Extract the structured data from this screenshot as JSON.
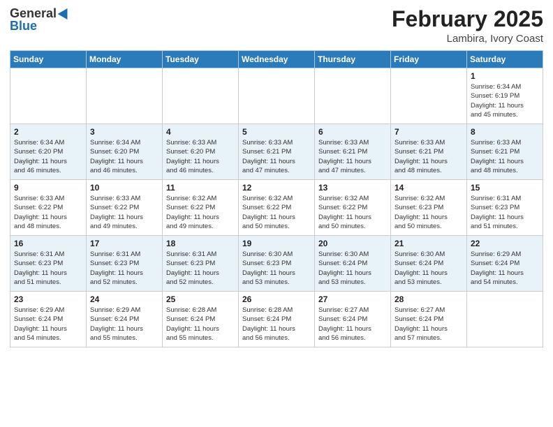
{
  "header": {
    "logo_general": "General",
    "logo_blue": "Blue",
    "title": "February 2025",
    "subtitle": "Lambira, Ivory Coast"
  },
  "days_of_week": [
    "Sunday",
    "Monday",
    "Tuesday",
    "Wednesday",
    "Thursday",
    "Friday",
    "Saturday"
  ],
  "weeks": [
    [
      {
        "day": "",
        "info": ""
      },
      {
        "day": "",
        "info": ""
      },
      {
        "day": "",
        "info": ""
      },
      {
        "day": "",
        "info": ""
      },
      {
        "day": "",
        "info": ""
      },
      {
        "day": "",
        "info": ""
      },
      {
        "day": "1",
        "info": "Sunrise: 6:34 AM\nSunset: 6:19 PM\nDaylight: 11 hours\nand 45 minutes."
      }
    ],
    [
      {
        "day": "2",
        "info": "Sunrise: 6:34 AM\nSunset: 6:20 PM\nDaylight: 11 hours\nand 46 minutes."
      },
      {
        "day": "3",
        "info": "Sunrise: 6:34 AM\nSunset: 6:20 PM\nDaylight: 11 hours\nand 46 minutes."
      },
      {
        "day": "4",
        "info": "Sunrise: 6:33 AM\nSunset: 6:20 PM\nDaylight: 11 hours\nand 46 minutes."
      },
      {
        "day": "5",
        "info": "Sunrise: 6:33 AM\nSunset: 6:21 PM\nDaylight: 11 hours\nand 47 minutes."
      },
      {
        "day": "6",
        "info": "Sunrise: 6:33 AM\nSunset: 6:21 PM\nDaylight: 11 hours\nand 47 minutes."
      },
      {
        "day": "7",
        "info": "Sunrise: 6:33 AM\nSunset: 6:21 PM\nDaylight: 11 hours\nand 48 minutes."
      },
      {
        "day": "8",
        "info": "Sunrise: 6:33 AM\nSunset: 6:21 PM\nDaylight: 11 hours\nand 48 minutes."
      }
    ],
    [
      {
        "day": "9",
        "info": "Sunrise: 6:33 AM\nSunset: 6:22 PM\nDaylight: 11 hours\nand 48 minutes."
      },
      {
        "day": "10",
        "info": "Sunrise: 6:33 AM\nSunset: 6:22 PM\nDaylight: 11 hours\nand 49 minutes."
      },
      {
        "day": "11",
        "info": "Sunrise: 6:32 AM\nSunset: 6:22 PM\nDaylight: 11 hours\nand 49 minutes."
      },
      {
        "day": "12",
        "info": "Sunrise: 6:32 AM\nSunset: 6:22 PM\nDaylight: 11 hours\nand 50 minutes."
      },
      {
        "day": "13",
        "info": "Sunrise: 6:32 AM\nSunset: 6:22 PM\nDaylight: 11 hours\nand 50 minutes."
      },
      {
        "day": "14",
        "info": "Sunrise: 6:32 AM\nSunset: 6:23 PM\nDaylight: 11 hours\nand 50 minutes."
      },
      {
        "day": "15",
        "info": "Sunrise: 6:31 AM\nSunset: 6:23 PM\nDaylight: 11 hours\nand 51 minutes."
      }
    ],
    [
      {
        "day": "16",
        "info": "Sunrise: 6:31 AM\nSunset: 6:23 PM\nDaylight: 11 hours\nand 51 minutes."
      },
      {
        "day": "17",
        "info": "Sunrise: 6:31 AM\nSunset: 6:23 PM\nDaylight: 11 hours\nand 52 minutes."
      },
      {
        "day": "18",
        "info": "Sunrise: 6:31 AM\nSunset: 6:23 PM\nDaylight: 11 hours\nand 52 minutes."
      },
      {
        "day": "19",
        "info": "Sunrise: 6:30 AM\nSunset: 6:23 PM\nDaylight: 11 hours\nand 53 minutes."
      },
      {
        "day": "20",
        "info": "Sunrise: 6:30 AM\nSunset: 6:24 PM\nDaylight: 11 hours\nand 53 minutes."
      },
      {
        "day": "21",
        "info": "Sunrise: 6:30 AM\nSunset: 6:24 PM\nDaylight: 11 hours\nand 53 minutes."
      },
      {
        "day": "22",
        "info": "Sunrise: 6:29 AM\nSunset: 6:24 PM\nDaylight: 11 hours\nand 54 minutes."
      }
    ],
    [
      {
        "day": "23",
        "info": "Sunrise: 6:29 AM\nSunset: 6:24 PM\nDaylight: 11 hours\nand 54 minutes."
      },
      {
        "day": "24",
        "info": "Sunrise: 6:29 AM\nSunset: 6:24 PM\nDaylight: 11 hours\nand 55 minutes."
      },
      {
        "day": "25",
        "info": "Sunrise: 6:28 AM\nSunset: 6:24 PM\nDaylight: 11 hours\nand 55 minutes."
      },
      {
        "day": "26",
        "info": "Sunrise: 6:28 AM\nSunset: 6:24 PM\nDaylight: 11 hours\nand 56 minutes."
      },
      {
        "day": "27",
        "info": "Sunrise: 6:27 AM\nSunset: 6:24 PM\nDaylight: 11 hours\nand 56 minutes."
      },
      {
        "day": "28",
        "info": "Sunrise: 6:27 AM\nSunset: 6:24 PM\nDaylight: 11 hours\nand 57 minutes."
      },
      {
        "day": "",
        "info": ""
      }
    ]
  ]
}
